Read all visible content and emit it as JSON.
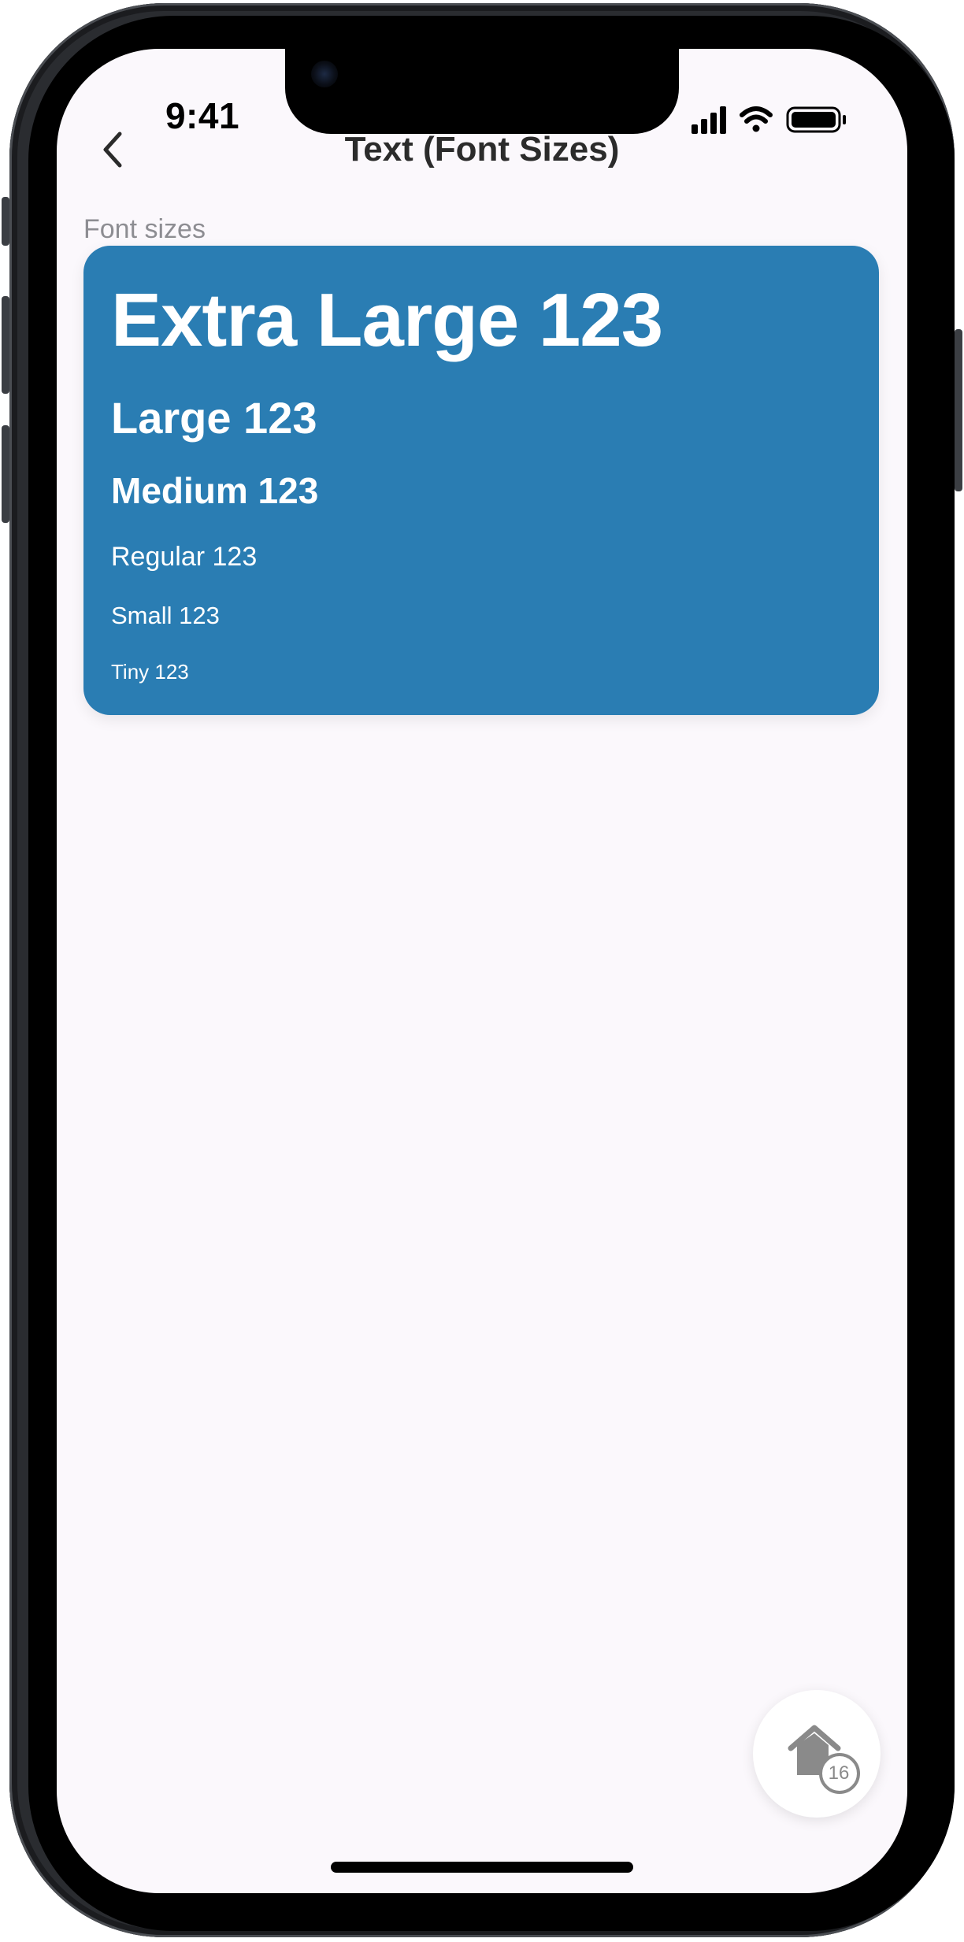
{
  "status_bar": {
    "time": "9:41",
    "signal_icon": "cellular-signal-icon",
    "wifi_icon": "wifi-icon",
    "battery_icon": "battery-icon"
  },
  "nav": {
    "back_icon": "chevron-left-icon",
    "title": "Text (Font Sizes)"
  },
  "section": {
    "label": "Font sizes"
  },
  "card": {
    "background_color": "#2A7DB3",
    "text_color": "#FFFFFF",
    "samples": {
      "extra_large": "Extra Large 123",
      "large": "Large 123",
      "medium": "Medium 123",
      "regular": "Regular 123",
      "small": "Small 123",
      "tiny": "Tiny 123"
    }
  },
  "fab": {
    "icon": "home-icon",
    "badge_count": "16"
  },
  "colors": {
    "screen_background": "#FBF8FC",
    "title_text": "#2B2B2B",
    "label_text": "#8D8D92",
    "fab_icon": "#8A8A8A"
  }
}
